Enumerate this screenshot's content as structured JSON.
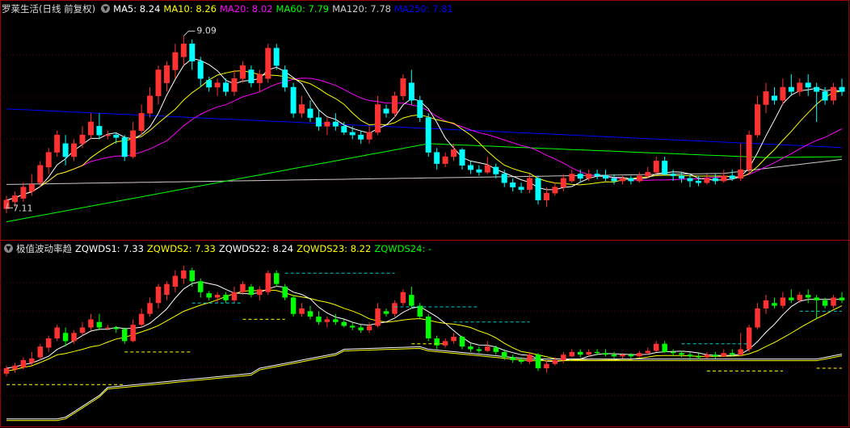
{
  "main_panel": {
    "title": "罗莱生活(日线 前复权)",
    "ma": [
      {
        "label": "MA5: 8.24",
        "color": "#ffffff"
      },
      {
        "label": "MA10: 8.26",
        "color": "#ffff00"
      },
      {
        "label": "MA20: 8.02",
        "color": "#ff00ff"
      },
      {
        "label": "MA60: 7.79",
        "color": "#00ff00"
      },
      {
        "label": "MA120: 7.78",
        "color": "#cccccc"
      },
      {
        "label": "MA250: 7.81",
        "color": "#0000ff"
      }
    ],
    "high_marker": "9.09",
    "low_marker": "7.11"
  },
  "indicator_panel": {
    "title": "极值波动率趋",
    "lines": [
      {
        "label": "ZQWDS1: 7.33",
        "color": "#ffffff"
      },
      {
        "label": "ZQWDS2: 7.33",
        "color": "#ffff00"
      },
      {
        "label": "ZQWDS22: 8.24",
        "color": "#ffffff"
      },
      {
        "label": "ZQWDS23: 8.22",
        "color": "#ffff00"
      },
      {
        "label": "ZQWDS24: -",
        "color": "#00ff00"
      }
    ]
  },
  "colors": {
    "up": "#ff3232",
    "down": "#00ffff",
    "ind_up": "#ff3232",
    "ind_down": "#00ff00",
    "ma5": "#ffffff",
    "ma10": "#ffff00",
    "ma20": "#ff00ff",
    "ma60": "#00ff00",
    "ma120": "#cccccc",
    "ma250": "#0000ff",
    "grid": "#5a0000",
    "frame": "#a00000"
  },
  "chart_data": {
    "type": "candlestick",
    "price_range": [
      6.9,
      9.3
    ],
    "candles": [
      [
        7.1,
        7.2,
        7.25,
        7.05
      ],
      [
        7.18,
        7.25,
        7.3,
        7.12
      ],
      [
        7.22,
        7.35,
        7.4,
        7.18
      ],
      [
        7.3,
        7.38,
        7.5,
        7.25
      ],
      [
        7.4,
        7.6,
        7.65,
        7.35
      ],
      [
        7.58,
        7.75,
        7.8,
        7.5
      ],
      [
        7.75,
        7.95,
        8.0,
        7.7
      ],
      [
        7.85,
        7.7,
        7.95,
        7.6
      ],
      [
        7.7,
        7.85,
        7.9,
        7.65
      ],
      [
        7.85,
        7.95,
        8.05,
        7.8
      ],
      [
        7.95,
        8.1,
        8.2,
        7.9
      ],
      [
        8.05,
        7.95,
        8.2,
        7.9
      ],
      [
        7.95,
        7.95,
        8.0,
        7.9
      ],
      [
        7.95,
        7.92,
        7.98,
        7.85
      ],
      [
        7.92,
        7.7,
        7.95,
        7.65
      ],
      [
        7.7,
        8.0,
        8.1,
        7.68
      ],
      [
        8.0,
        8.2,
        8.3,
        7.95
      ],
      [
        8.2,
        8.4,
        8.5,
        8.15
      ],
      [
        8.4,
        8.7,
        8.75,
        8.3
      ],
      [
        8.55,
        8.75,
        8.8,
        8.45
      ],
      [
        8.7,
        8.9,
        9.0,
        8.6
      ],
      [
        8.85,
        9.0,
        9.09,
        8.75
      ],
      [
        9.0,
        8.8,
        9.05,
        8.7
      ],
      [
        8.8,
        8.6,
        8.85,
        8.5
      ],
      [
        8.58,
        8.5,
        8.62,
        8.45
      ],
      [
        8.5,
        8.55,
        8.6,
        8.4
      ],
      [
        8.55,
        8.45,
        8.6,
        8.4
      ],
      [
        8.45,
        8.6,
        8.7,
        8.4
      ],
      [
        8.6,
        8.75,
        8.8,
        8.55
      ],
      [
        8.7,
        8.55,
        8.75,
        8.5
      ],
      [
        8.55,
        8.65,
        8.7,
        8.45
      ],
      [
        8.6,
        8.95,
        9.0,
        8.55
      ],
      [
        8.95,
        8.75,
        9.0,
        8.7
      ],
      [
        8.7,
        8.5,
        8.75,
        8.45
      ],
      [
        8.5,
        8.2,
        8.55,
        8.15
      ],
      [
        8.2,
        8.3,
        8.4,
        8.15
      ],
      [
        8.25,
        8.15,
        8.35,
        8.1
      ],
      [
        8.15,
        8.05,
        8.25,
        8.0
      ],
      [
        8.05,
        8.1,
        8.15,
        7.95
      ],
      [
        8.1,
        8.05,
        8.2,
        8.0
      ],
      [
        8.05,
        7.98,
        8.1,
        7.95
      ],
      [
        7.98,
        7.95,
        8.05,
        7.9
      ],
      [
        7.95,
        7.9,
        8.0,
        7.85
      ],
      [
        7.9,
        7.98,
        8.05,
        7.85
      ],
      [
        7.98,
        8.3,
        8.4,
        7.95
      ],
      [
        8.25,
        8.2,
        8.3,
        8.15
      ],
      [
        8.2,
        8.4,
        8.45,
        8.15
      ],
      [
        8.4,
        8.6,
        8.65,
        8.35
      ],
      [
        8.55,
        8.35,
        8.7,
        8.3
      ],
      [
        8.35,
        8.15,
        8.4,
        8.1
      ],
      [
        8.15,
        7.75,
        8.2,
        7.7
      ],
      [
        7.75,
        7.62,
        7.8,
        7.55
      ],
      [
        7.62,
        7.7,
        7.75,
        7.58
      ],
      [
        7.7,
        7.78,
        7.85,
        7.65
      ],
      [
        7.78,
        7.6,
        7.8,
        7.55
      ],
      [
        7.6,
        7.55,
        7.65,
        7.5
      ],
      [
        7.55,
        7.52,
        7.6,
        7.48
      ],
      [
        7.52,
        7.6,
        7.7,
        7.5
      ],
      [
        7.58,
        7.5,
        7.62,
        7.45
      ],
      [
        7.5,
        7.4,
        7.55,
        7.35
      ],
      [
        7.4,
        7.35,
        7.45,
        7.3
      ],
      [
        7.35,
        7.32,
        7.4,
        7.28
      ],
      [
        7.32,
        7.45,
        7.5,
        7.28
      ],
      [
        7.45,
        7.2,
        7.48,
        7.15
      ],
      [
        7.2,
        7.28,
        7.35,
        7.12
      ],
      [
        7.28,
        7.35,
        7.4,
        7.25
      ],
      [
        7.35,
        7.45,
        7.5,
        7.3
      ],
      [
        7.42,
        7.5,
        7.55,
        7.4
      ],
      [
        7.5,
        7.45,
        7.55,
        7.4
      ],
      [
        7.45,
        7.5,
        7.55,
        7.42
      ],
      [
        7.5,
        7.48,
        7.55,
        7.44
      ],
      [
        7.48,
        7.45,
        7.55,
        7.42
      ],
      [
        7.45,
        7.42,
        7.5,
        7.38
      ],
      [
        7.42,
        7.45,
        7.48,
        7.38
      ],
      [
        7.45,
        7.42,
        7.48,
        7.38
      ],
      [
        7.42,
        7.48,
        7.52,
        7.4
      ],
      [
        7.48,
        7.52,
        7.58,
        7.45
      ],
      [
        7.52,
        7.65,
        7.7,
        7.5
      ],
      [
        7.65,
        7.5,
        7.7,
        7.48
      ],
      [
        7.5,
        7.48,
        7.55,
        7.42
      ],
      [
        7.48,
        7.45,
        7.52,
        7.4
      ],
      [
        7.45,
        7.42,
        7.5,
        7.35
      ],
      [
        7.42,
        7.4,
        7.48,
        7.36
      ],
      [
        7.4,
        7.45,
        7.5,
        7.38
      ],
      [
        7.45,
        7.42,
        7.5,
        7.38
      ],
      [
        7.42,
        7.48,
        7.55,
        7.4
      ],
      [
        7.48,
        7.45,
        7.55,
        7.42
      ],
      [
        7.45,
        7.55,
        7.85,
        7.42
      ],
      [
        7.55,
        7.95,
        8.0,
        7.5
      ],
      [
        7.95,
        8.3,
        8.4,
        7.92
      ],
      [
        8.3,
        8.45,
        8.55,
        8.2
      ],
      [
        8.4,
        8.35,
        8.5,
        8.3
      ],
      [
        8.35,
        8.5,
        8.6,
        8.3
      ],
      [
        8.5,
        8.45,
        8.65,
        8.4
      ],
      [
        8.45,
        8.55,
        8.6,
        8.4
      ],
      [
        8.55,
        8.5,
        8.65,
        8.4
      ],
      [
        8.5,
        8.45,
        8.55,
        8.1
      ],
      [
        8.45,
        8.35,
        8.5,
        8.3
      ],
      [
        8.35,
        8.5,
        8.55,
        8.3
      ],
      [
        8.5,
        8.45,
        8.6,
        8.4
      ]
    ]
  }
}
